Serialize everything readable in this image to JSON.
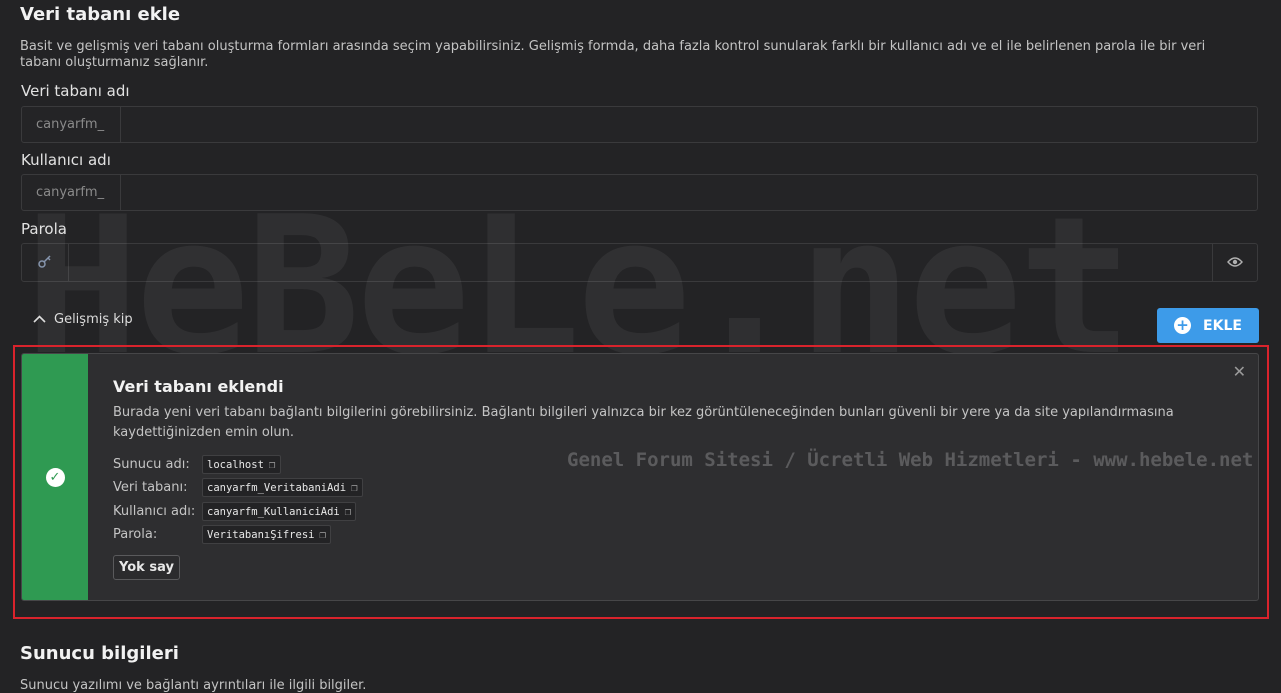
{
  "form": {
    "title": "Veri tabanı ekle",
    "description": "Basit ve gelişmiş veri tabanı oluşturma formları arasında seçim yapabilirsiniz. Gelişmiş formda, daha fazla kontrol sunularak farklı bir kullanıcı adı ve el ile belirlenen parola ile bir veri tabanı oluşturmanız sağlanır.",
    "db_name_label": "Veri tabanı adı",
    "db_name_prefix": "canyarfm_",
    "db_name_value": "",
    "username_label": "Kullanıcı adı",
    "username_prefix": "canyarfm_",
    "username_value": "",
    "password_label": "Parola",
    "password_value": "",
    "advanced_toggle_label": "Gelişmiş kip",
    "add_button_label": "EKLE"
  },
  "notice": {
    "title": "Veri tabanı eklendi",
    "description": "Burada yeni veri tabanı bağlantı bilgilerini görebilirsiniz. Bağlantı bilgileri yalnızca bir kez görüntüleneceğinden bunları güvenli bir yere ya da site yapılandırmasına kaydettiğinizden emin olun.",
    "rows": [
      {
        "key": "Sunucu adı:",
        "value": "localhost"
      },
      {
        "key": "Veri tabanı:",
        "value": "canyarfm_VeritabaniAdi"
      },
      {
        "key": "Kullanıcı adı:",
        "value": "canyarfm_KullaniciAdi"
      },
      {
        "key": "Parola:",
        "value": "VeritabanıŞifresi"
      }
    ],
    "dismiss_label": "Yok say"
  },
  "server_info": {
    "title": "Sunucu bilgileri",
    "description": "Sunucu yazılımı ve bağlantı ayrıntıları ile ilgili bilgiler."
  },
  "watermark": {
    "big": "HeBeLe.net",
    "small": "Genel Forum Sitesi / Ücretli Web Hizmetleri - www.hebele.net"
  },
  "icons": {
    "toggle": "chevron-up-icon",
    "add": "plus-circle-icon",
    "success": "check-circle-icon",
    "close": "close-icon",
    "copy": "copy-icon",
    "generate": "key-generate-icon",
    "visibility": "eye-icon"
  },
  "colors": {
    "background": "#232325",
    "primary_button": "#3d9be9",
    "success": "#2f9a52",
    "highlight_border": "#d9232c"
  }
}
